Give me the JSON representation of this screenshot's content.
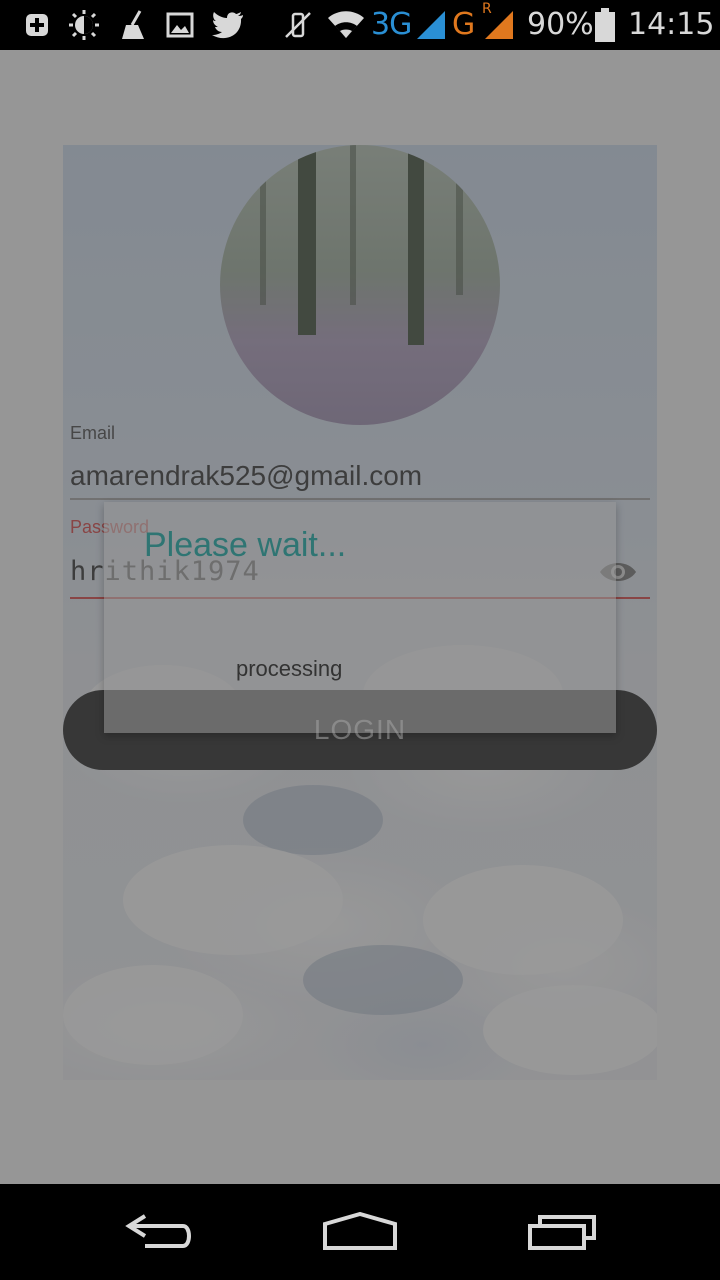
{
  "status_bar": {
    "network_3g": "3G",
    "network_g": "G",
    "roaming": "R",
    "battery_percent": "90%",
    "time": "14:15",
    "icons": [
      "plus-notification-icon",
      "brightness-icon",
      "cleaner-icon",
      "image-icon",
      "twitter-icon",
      "vibrate-icon",
      "wifi-icon",
      "signal-icon",
      "signal-icon",
      "battery-icon"
    ]
  },
  "login": {
    "email_label": "Email",
    "email_value": "amarendrak525@gmail.com",
    "password_label": "Password",
    "password_value": "hrithik1974",
    "login_button": "LOGIN"
  },
  "dialog": {
    "title": "Please wait...",
    "message": "processing"
  },
  "colors": {
    "accent": "#4fc3c0",
    "error": "#e57373",
    "scrim": "rgba(0,0,0,0.40)"
  },
  "nav_bar": {
    "icons": [
      "back-icon",
      "home-icon",
      "recents-icon"
    ]
  }
}
